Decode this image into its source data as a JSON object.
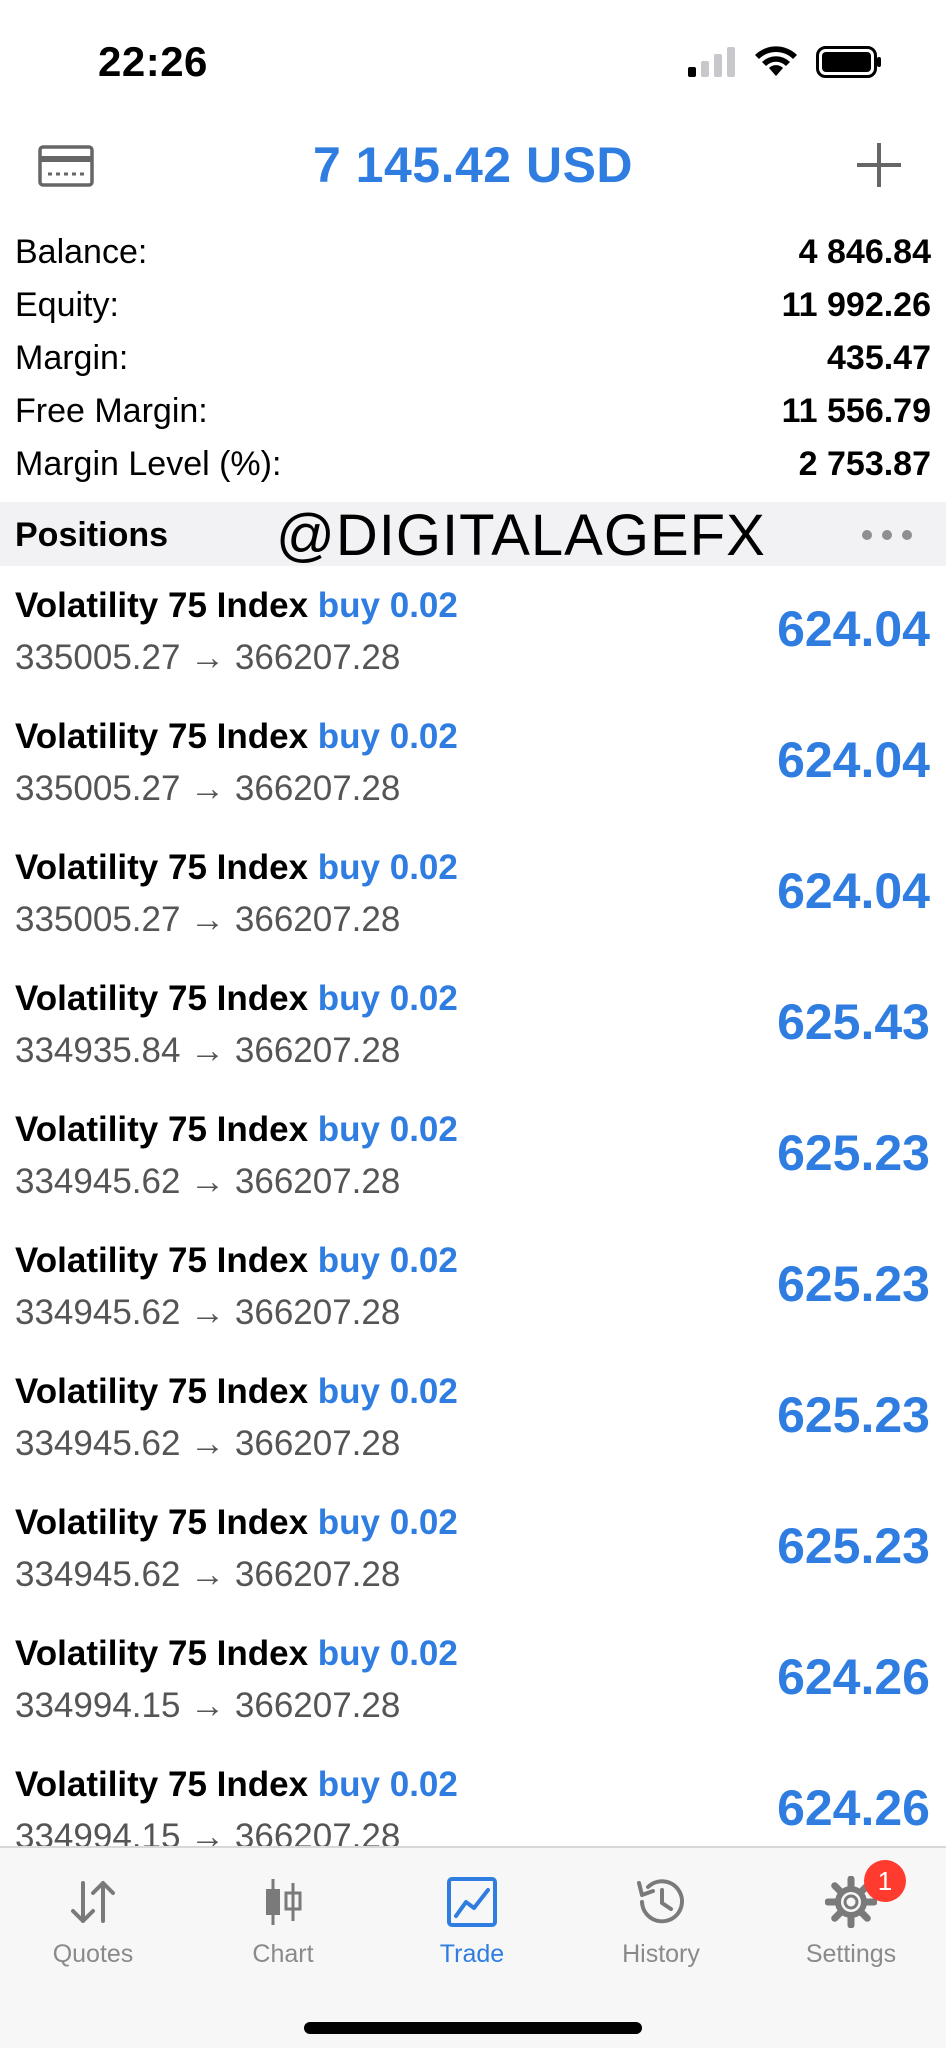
{
  "status_bar": {
    "time": "22:26"
  },
  "header": {
    "title": "7 145.42 USD"
  },
  "summary": [
    {
      "label": "Balance:",
      "value": "4 846.84"
    },
    {
      "label": "Equity:",
      "value": "11 992.26"
    },
    {
      "label": "Margin:",
      "value": "435.47"
    },
    {
      "label": "Free Margin:",
      "value": "11 556.79"
    },
    {
      "label": "Margin Level (%):",
      "value": "2 753.87"
    }
  ],
  "positions_header": {
    "label": "Positions",
    "watermark": "@DIGITALAGEFX"
  },
  "positions": [
    {
      "symbol": "Volatility 75 Index",
      "side": "buy 0.02",
      "prices": "335005.27 → 366207.28",
      "profit": "624.04"
    },
    {
      "symbol": "Volatility 75 Index",
      "side": "buy 0.02",
      "prices": "335005.27 → 366207.28",
      "profit": "624.04"
    },
    {
      "symbol": "Volatility 75 Index",
      "side": "buy 0.02",
      "prices": "335005.27 → 366207.28",
      "profit": "624.04"
    },
    {
      "symbol": "Volatility 75 Index",
      "side": "buy 0.02",
      "prices": "334935.84 → 366207.28",
      "profit": "625.43"
    },
    {
      "symbol": "Volatility 75 Index",
      "side": "buy 0.02",
      "prices": "334945.62 → 366207.28",
      "profit": "625.23"
    },
    {
      "symbol": "Volatility 75 Index",
      "side": "buy 0.02",
      "prices": "334945.62 → 366207.28",
      "profit": "625.23"
    },
    {
      "symbol": "Volatility 75 Index",
      "side": "buy 0.02",
      "prices": "334945.62 → 366207.28",
      "profit": "625.23"
    },
    {
      "symbol": "Volatility 75 Index",
      "side": "buy 0.02",
      "prices": "334945.62 → 366207.28",
      "profit": "625.23"
    },
    {
      "symbol": "Volatility 75 Index",
      "side": "buy 0.02",
      "prices": "334994.15 → 366207.28",
      "profit": "624.26"
    },
    {
      "symbol": "Volatility 75 Index",
      "side": "buy 0.02",
      "prices": "334994.15 → 366207.28",
      "profit": "624.26"
    }
  ],
  "tabs": [
    {
      "label": "Quotes",
      "icon": "quotes-arrows-icon"
    },
    {
      "label": "Chart",
      "icon": "candlestick-icon"
    },
    {
      "label": "Trade",
      "icon": "trade-chart-icon",
      "active": true
    },
    {
      "label": "History",
      "icon": "history-clock-icon"
    },
    {
      "label": "Settings",
      "icon": "gear-icon",
      "badge": "1"
    }
  ],
  "colors": {
    "accent": "#2f7de1",
    "badge": "#ff3b30",
    "muted": "#8a8a8a"
  }
}
